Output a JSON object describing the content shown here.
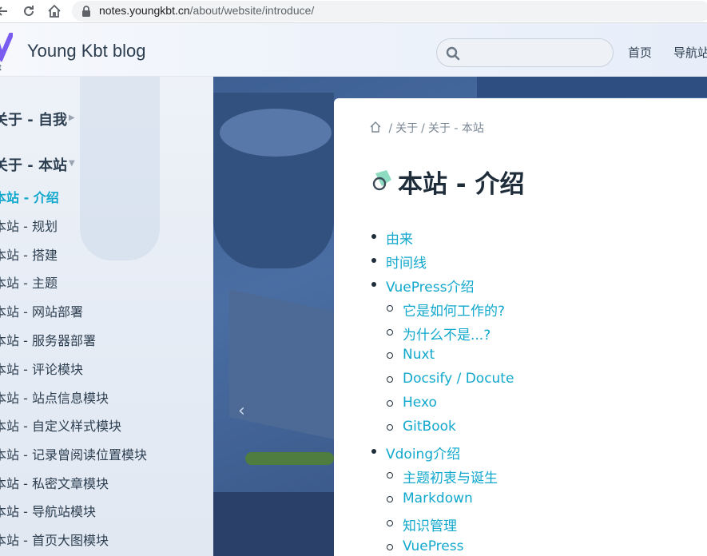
{
  "browser": {
    "url_host": "notes.youngkbt.cn",
    "url_path": "/about/website/introduce/"
  },
  "header": {
    "logo_text": "kbt",
    "site_name": "Young Kbt blog",
    "search_placeholder": "",
    "nav": [
      "首页",
      "导航站"
    ]
  },
  "sidebar": {
    "groups": [
      {
        "label": "关于 - 自我",
        "expanded": false
      },
      {
        "label": "关于 - 本站",
        "expanded": true
      }
    ],
    "items": [
      {
        "label": "本站 - 介绍",
        "active": true
      },
      {
        "label": "本站 - 规划",
        "active": false
      },
      {
        "label": "本站 - 搭建",
        "active": false
      },
      {
        "label": "本站 - 主题",
        "active": false
      },
      {
        "label": "本站 - 网站部署",
        "active": false
      },
      {
        "label": "本站 - 服务器部署",
        "active": false
      },
      {
        "label": "本站 - 评论模块",
        "active": false
      },
      {
        "label": "本站 - 站点信息模块",
        "active": false
      },
      {
        "label": "本站 - 自定义样式模块",
        "active": false
      },
      {
        "label": "本站 - 记录曾阅读位置模块",
        "active": false
      },
      {
        "label": "本站 - 私密文章模块",
        "active": false
      },
      {
        "label": "本站 - 导航站模块",
        "active": false
      },
      {
        "label": "本站 - 首页大图模块",
        "active": false
      }
    ]
  },
  "main": {
    "breadcrumb": [
      "关于",
      "关于 - 本站"
    ],
    "title": "本站 - 介绍",
    "toc": [
      {
        "label": "由来",
        "level": 1
      },
      {
        "label": "时间线",
        "level": 1
      },
      {
        "label": "VuePress介绍",
        "level": 1
      },
      {
        "label": "它是如何工作的?",
        "level": 2
      },
      {
        "label": "为什么不是...?",
        "level": 2
      },
      {
        "label": "Nuxt",
        "level": 2
      },
      {
        "label": "Docsify / Docute",
        "level": 2
      },
      {
        "label": "Hexo",
        "level": 2
      },
      {
        "label": "GitBook",
        "level": 2
      },
      {
        "label": "Vdoing介绍",
        "level": 1
      },
      {
        "label": "主题初衷与诞生",
        "level": 2
      },
      {
        "label": "Markdown",
        "level": 2
      },
      {
        "label": "知识管理",
        "level": 2
      },
      {
        "label": "VuePress",
        "level": 2
      }
    ]
  },
  "colors": {
    "accent": "#11a8cd",
    "text": "#2c3e50"
  }
}
